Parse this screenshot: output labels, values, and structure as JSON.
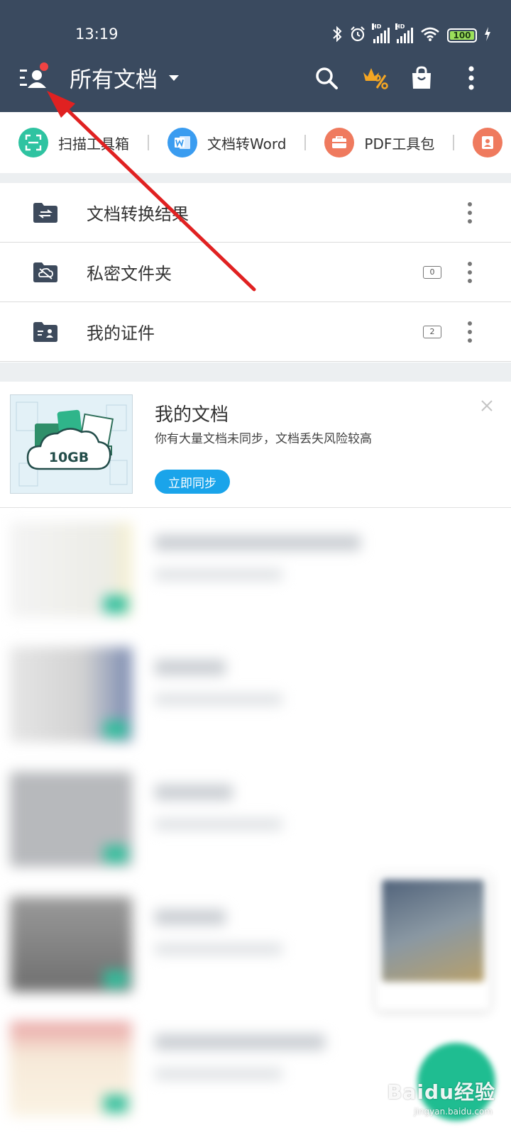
{
  "status_bar": {
    "time": "13:19",
    "hd_label": "HD",
    "battery": "100",
    "icons": [
      "bluetooth-icon",
      "alarm-icon",
      "signal-hd-icon",
      "signal-hd-icon",
      "wifi-icon",
      "battery-icon",
      "charging-icon"
    ]
  },
  "toolbar": {
    "title": "所有文档",
    "icons": [
      "account-menu-icon",
      "search-icon",
      "vip-discount-icon",
      "shopping-bag-icon",
      "more-vert-icon"
    ],
    "notification_dot_color": "#ef4343",
    "vip_color": "#f5a623"
  },
  "quick_tools": [
    {
      "label": "扫描工具箱",
      "icon": "scan-icon",
      "color": "#2fc3a1"
    },
    {
      "label": "文档转Word",
      "icon": "word-icon",
      "color": "#3a9cf0"
    },
    {
      "label": "PDF工具包",
      "icon": "toolbox-icon",
      "color": "#ef7a5e"
    }
  ],
  "folders": [
    {
      "label": "文档转换结果",
      "icon": "convert-folder-icon",
      "count": ""
    },
    {
      "label": "私密文件夹",
      "icon": "private-folder-icon",
      "count": "0"
    },
    {
      "label": "我的证件",
      "icon": "id-card-folder-icon",
      "count": "2"
    }
  ],
  "promo": {
    "title": "我的文档",
    "subtitle": "你有大量文档未同步，文档丢失风险较高",
    "button": "立即同步",
    "storage_label": "10GB",
    "accent": "#1aa4ea"
  },
  "annotation": {
    "type": "red-arrow",
    "target": "account-menu-button",
    "color": "#e02121"
  },
  "watermark": {
    "brand": "Baidu经验",
    "url": "jingyan.baidu.com"
  }
}
